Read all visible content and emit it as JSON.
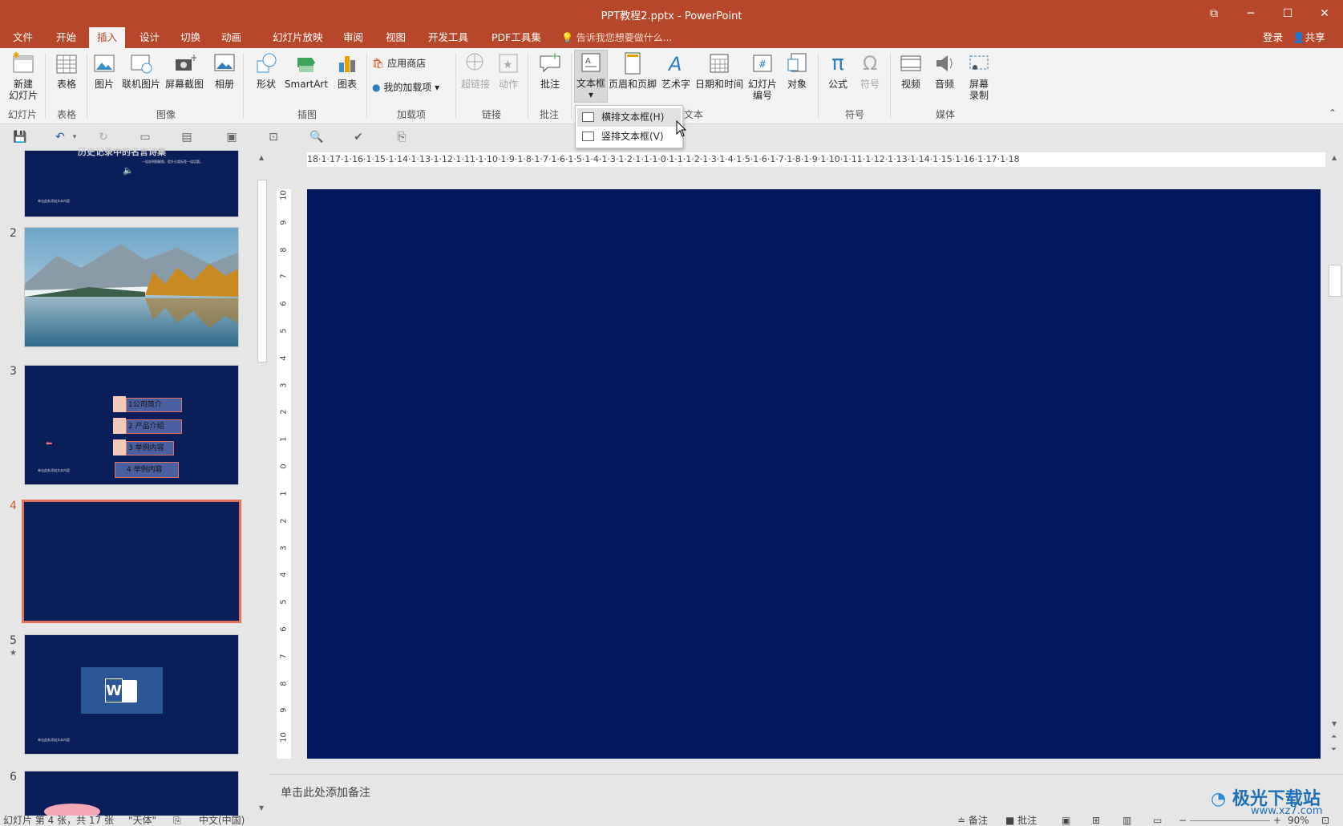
{
  "window": {
    "title": "PPT教程2.pptx - PowerPoint"
  },
  "tabs": [
    "文件",
    "开始",
    "插入",
    "设计",
    "切换",
    "动画",
    "幻灯片放映",
    "审阅",
    "视图",
    "开发工具",
    "PDF工具集"
  ],
  "tellme": "告诉我您想要做什么...",
  "account": {
    "login": "登录",
    "share": "共享"
  },
  "ribbon": {
    "new_slide": "新建\n幻灯片",
    "table": "表格",
    "picture": "图片",
    "online_picture": "联机图片",
    "screenshot": "屏幕截图",
    "album": "相册",
    "shapes": "形状",
    "smartart": "SmartArt",
    "chart": "图表",
    "store": "应用商店",
    "my_addins": "我的加载项",
    "hyperlink": "超链接",
    "action": "动作",
    "comment": "批注",
    "textbox": "文本框",
    "header_footer": "页眉和页脚",
    "wordart": "艺术字",
    "datetime": "日期和时间",
    "slide_number": "幻灯片\n编号",
    "object": "对象",
    "equation": "公式",
    "symbol": "符号",
    "video": "视频",
    "audio": "音频",
    "screen_record": "屏幕\n录制",
    "groups": {
      "slides": "幻灯片",
      "tables": "表格",
      "images": "图像",
      "illustrations": "插图",
      "addins": "加载项",
      "links": "链接",
      "comments": "批注",
      "text": "文本",
      "symbols": "符号",
      "media": "媒体"
    }
  },
  "dropdown": {
    "horizontal": "横排文本框(H)",
    "vertical": "竖排文本框(V)"
  },
  "thumbnails": {
    "s1_title": "历史记录中的名言诗集",
    "s1_sub": "一组说明图解图，提升分类标签一组话题。",
    "s1_foot": "单击此处添加文本内容",
    "s3_items": [
      "1公司简介",
      "2 产品介绍",
      "3 举例内容",
      "4 举例内容"
    ],
    "s3_foot": "单击此处添加文本内容",
    "s5_foot": "单击此处添加文本内容",
    "numbers": [
      "2",
      "3",
      "4",
      "5",
      "6"
    ]
  },
  "ruler_h": "18·1·17·1·16·1·15·1·14·1·13·1·12·1·11·1·10·1·9·1·8·1·7·1·6·1·5·1·4·1·3·1·2·1·1·1·0·1·1·1·2·1·3·1·4·1·5·1·6·1·7·1·8·1·9·1·10·1·11·1·12·1·13·1·14·1·15·1·16·1·17·1·18",
  "ruler_v": [
    "10",
    "9",
    "8",
    "7",
    "6",
    "5",
    "4",
    "3",
    "2",
    "1",
    "0",
    "1",
    "2",
    "3",
    "4",
    "5",
    "6",
    "7",
    "8",
    "9",
    "10"
  ],
  "notes_placeholder": "单击此处添加备注",
  "status": {
    "slide": "幻灯片 第 4 张，共 17 张",
    "theme": "\"天体\"",
    "lang": "中文(中国)",
    "notes": "备注",
    "comments": "批注",
    "zoom": "90%"
  },
  "watermark": {
    "name": "极光下载站",
    "url": "www.xz7.com"
  },
  "colors": {
    "accent": "#b7472a",
    "slide_bg": "#03175e"
  }
}
